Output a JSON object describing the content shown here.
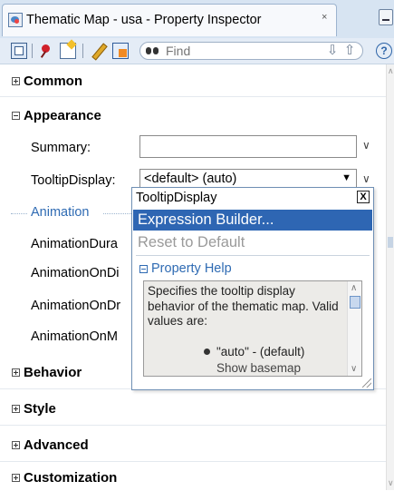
{
  "window": {
    "tab_title": "Thematic Map - usa - Property Inspector",
    "tab_close": "×"
  },
  "toolbar": {
    "find_placeholder": "Find",
    "find_down": "⇩",
    "find_up": "⇧",
    "help": "?"
  },
  "sections": {
    "common": "Common",
    "appearance": "Appearance",
    "behavior": "Behavior",
    "style": "Style",
    "advanced": "Advanced",
    "customization": "Customization"
  },
  "appearance": {
    "summary_label": "Summary:",
    "summary_value": "",
    "tooltip_label": "TooltipDisplay:",
    "tooltip_value": "<default> (auto)",
    "animation_group": "Animation",
    "animation_props": [
      "AnimationDura",
      "AnimationOnDi",
      "AnimationOnDr",
      "AnimationOnM"
    ]
  },
  "popup": {
    "title": "TooltipDisplay",
    "close": "X",
    "menu_expression": "Expression Builder...",
    "menu_reset": "Reset to Default",
    "property_help_title": "Property Help",
    "help_text": "Specifies the tooltip display behavior of the thematic map. Valid values are:",
    "help_bullet": "\"auto\" - (default)",
    "help_bullet_cont": "Show basemap"
  },
  "colors": {
    "accent": "#2e66b3",
    "link_blue": "#2f6bb3",
    "titlebar": "#d7e4f2"
  }
}
